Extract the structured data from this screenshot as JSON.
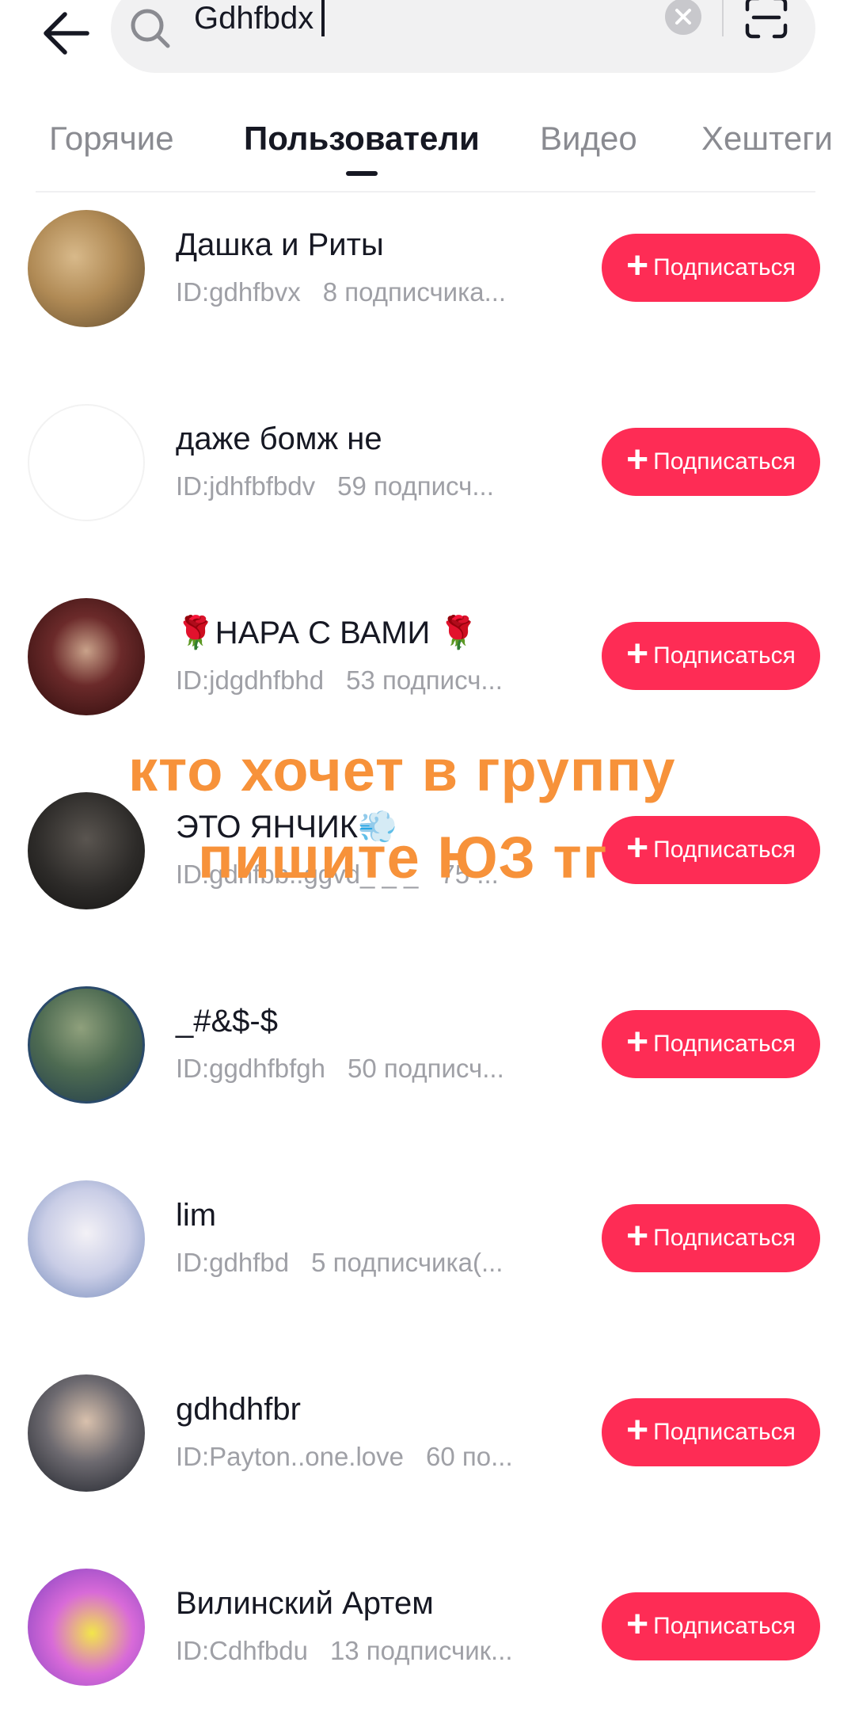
{
  "search": {
    "query": "Gdhfbdx"
  },
  "tabs": [
    "Горячие",
    "Пользователи",
    "Видео",
    "Хештеги"
  ],
  "follow_label": "Подписаться",
  "users": [
    {
      "name": "Дашка  и Риты",
      "id": "ID:gdhfbvx",
      "followers": "8 подписчика..."
    },
    {
      "name": "даже бомж не",
      "id": "ID:jdhfbfbdv",
      "followers": "59 подписч..."
    },
    {
      "name": "🌹НАРА С ВАМИ 🌹",
      "id": "ID:jdgdhfbhd",
      "followers": "53 подписч..."
    },
    {
      "name": "ЭТО ЯНЧИК💨",
      "id": "ID:gdhfbb..ggvd_ _ _",
      "followers": "75 ..."
    },
    {
      "name": "_#&$-$",
      "id": "ID:ggdhfbfgh",
      "followers": "50 подписч..."
    },
    {
      "name": "lim",
      "id": "ID:gdhfbd",
      "followers": "5 подписчика(..."
    },
    {
      "name": "gdhdhfbr",
      "id": "ID:Payton..one.love",
      "followers": "60 по..."
    },
    {
      "name": "Вилинский Артем",
      "id": "ID:Cdhfbdu",
      "followers": "13 подписчик..."
    }
  ],
  "overlay": {
    "line1": "кто хочет в группу",
    "line2": "пишите ЮЗ тг"
  },
  "colors": {
    "accent": "#fe2c55",
    "overlay_text": "#f7923a"
  }
}
